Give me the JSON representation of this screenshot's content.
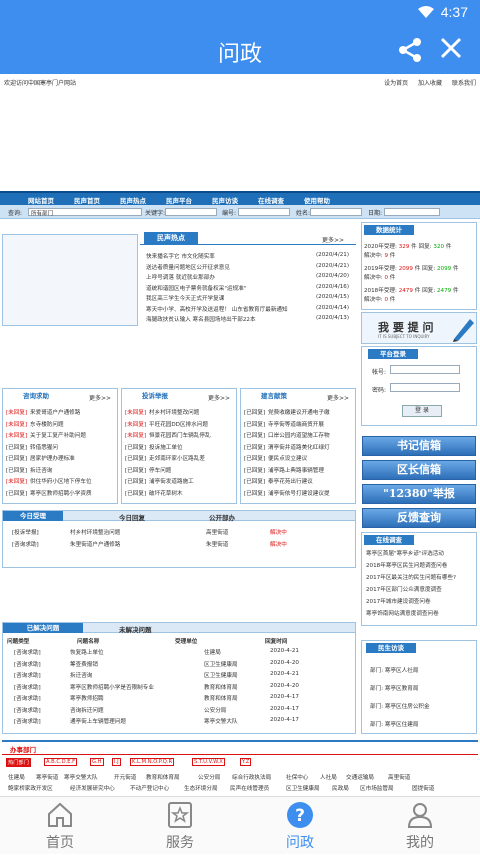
{
  "status": {
    "time": "4:37"
  },
  "appbar": {
    "title": "问政"
  },
  "web": {
    "welcome": "欢迎访问中国寒亭门户网站",
    "top_links": [
      "设为首页",
      "加入收藏",
      "联系我们"
    ],
    "nav": [
      "网站首页",
      "民声首页",
      "民声热点",
      "民声平台",
      "民声访谈",
      "在线调查",
      "使用帮助"
    ],
    "search": {
      "label1": "查询:",
      "dept": "所有部门",
      "label2": "关键字:",
      "label3": "编号:",
      "label4": "姓名:",
      "label5": "日期:"
    },
    "hot": {
      "title": "民声热点",
      "more": "更多>>",
      "items": [
        {
          "t": "快来播名字它    市文化随实率",
          "d": "(2020/4/21)"
        },
        {
          "t": "送达者质量问题地区公开征求意见",
          "d": "(2020/4/21)"
        },
        {
          "t": "上呼号调落    就近就业那部办",
          "d": "(2020/4/20)"
        },
        {
          "t": "道统和谐园区电子票务就备权采\"运规准\"",
          "d": "(2020/4/16)"
        },
        {
          "t": "我区高三学生今天正式开学复课",
          "d": "(2020/4/15)"
        },
        {
          "t": "寒天中小学、高校开学及送返程！ 山东省教育厅最新通知",
          "d": "(2020/4/14)"
        },
        {
          "t": "海腿政扶贫认输入 寒名县园场地出干部22本",
          "d": "(2020/4/13)"
        }
      ]
    },
    "stats": {
      "title": "数据统计",
      "rows": [
        {
          "a": "2020年受理: ",
          "n1": "329",
          "b": " 件 回复: ",
          "n2": "320",
          "c": " 件",
          "pending": "解决中: ",
          "p": "9",
          "pu": " 件"
        },
        {
          "a": "2019年受理: ",
          "n1": "2099",
          "b": " 件 回复: ",
          "n2": "2099",
          "c": " 件",
          "pending": "解决中: ",
          "p": "0",
          "pu": " 件"
        },
        {
          "a": "2018年受理: ",
          "n1": "2479",
          "b": " 件 回复: ",
          "n2": "2479",
          "c": " 件",
          "pending": "解决中: ",
          "p": "0",
          "pu": " 件"
        }
      ]
    },
    "ask": {
      "title": "我 要 提 问",
      "sub": "IT IS SUBJECT TO INQUIRY"
    },
    "login": {
      "title": "平台登录",
      "user": "帐号:",
      "pass": "密码:",
      "btn": "登 录"
    },
    "consult": {
      "title": "咨询求助",
      "more": "更多>>",
      "items": [
        [
          "[未回复]",
          "来爱哥道户户通修路"
        ],
        [
          "[未回复]",
          "东寺楼防问题"
        ],
        [
          "[未回复]",
          "关于复工复产补助问题"
        ],
        [
          "[已回复]",
          "转借悉猩问"
        ],
        [
          "[已回复]",
          "居家护理办理标准"
        ],
        [
          "[已回复]",
          "拆迁咨询"
        ],
        [
          "[未回复]",
          "供住华府小区地下停车位"
        ],
        [
          "[已回复]",
          "寒亭区教师招聘小学资质"
        ]
      ]
    },
    "complaint": {
      "title": "投诉举报",
      "more": "更多>>",
      "items": [
        [
          "[未回复]",
          "村乡村环境整改问题"
        ],
        [
          "[未回复]",
          "平旺花园DD区排水问题"
        ],
        [
          "[未回复]",
          "恒景花园西门车辆乱停乱"
        ],
        [
          "[已回复]",
          "投诉施工单位"
        ],
        [
          "[已回复]",
          "走郊南环家小区路乱差"
        ],
        [
          "[已回复]",
          "停车问题"
        ],
        [
          "[已回复]",
          "浦亭街发道路施工"
        ],
        [
          "[已回复]",
          "破坏花草树木"
        ]
      ]
    },
    "suggest": {
      "title": "建言献策",
      "more": "更多>>",
      "items": [
        [
          "[已回复]",
          "党费收缴建议开通电子缴"
        ],
        [
          "[已回复]",
          "寺亭街等道端商贸开展"
        ],
        [
          "[已回复]",
          "口岸公园内道望施工存物"
        ],
        [
          "[已回复]",
          "渭亭街并道路美化红绿灯"
        ],
        [
          "[已回复]",
          "便民点设立建议"
        ],
        [
          "[已回复]",
          "浦亭路上典路事辆管理"
        ],
        [
          "[已回复]",
          "泰亭花苑出行建议"
        ],
        [
          "[已回复]",
          "浦亭街依号打建设建议提"
        ]
      ]
    },
    "today": {
      "tabs": [
        "今日受理",
        "今日回复",
        "公开部办"
      ],
      "rows": [
        [
          "[投诉举报]",
          "村乡村环境整治问题",
          "高里街道",
          "解决中"
        ],
        [
          "[咨询求助]",
          "朱里街道户户通修路",
          "朱里街道",
          "解决中"
        ]
      ]
    },
    "unsolved": {
      "tabs": [
        "已解决问题",
        "未解决问题"
      ],
      "headers": [
        "问题类型",
        "问题名称",
        "受理单位",
        "回复时间"
      ],
      "rows": [
        [
          "[咨询求助]",
          "恢复路上单位",
          "住建局",
          "2020-4-21"
        ],
        [
          "[咨询求助]",
          "筹查费报销",
          "区卫生健康局",
          "2020-4-20"
        ],
        [
          "[咨询求助]",
          "拆迁咨询",
          "区卫生健康局",
          "2020-4-21"
        ],
        [
          "[咨询求助]",
          "寒亭区教师招聘小学是否限制专业",
          "教育和体育局",
          "2020-4-20"
        ],
        [
          "[咨询求助]",
          "寒亭教师招聘",
          "教育和体育局",
          "2020-4-17"
        ],
        [
          "[咨询求助]",
          "咨询拆迁问题",
          "公安分局",
          "2020-4-17"
        ],
        [
          "[咨询求助]",
          "通亭街上车辆管理问题",
          "寒亭交警大队",
          "2020-4-17"
        ]
      ]
    },
    "side_btns": [
      "书记信箱",
      "区长信箱",
      "\"12380\"举报",
      "反馈查询"
    ],
    "survey": {
      "title": "在线调查",
      "items": [
        "寒亭区首届\"寒亭乡谚\"评选活动",
        "2018年寒亭区民生问题调查问卷",
        "2017年区最关注的民生问题有哪些?",
        "2017年区部门公众满意度调查",
        "2017年城市建设调查问卷",
        "寒亭饰南网站满意度调查问卷"
      ]
    },
    "interview": {
      "title": "民生访谈",
      "items": [
        "部门: 寒亭区人社局",
        "部门: 寒亭区教育局",
        "部门: 寒亭区住房公积金",
        "部门: 寒亭区住建局"
      ]
    },
    "depts": {
      "title": "办事部门",
      "letters": [
        "热门部门",
        "A.B.C.D.E.F",
        "G.H",
        "I.J",
        "K.L.M.N.O.P.Q.R",
        "S.T.U.V.W.X",
        "Y.Z"
      ],
      "row1": [
        "住建局",
        "寒亭街道",
        "寒亭交警大队",
        "开元街道",
        "教育和体育局",
        "公安分局",
        "综合行政执法局",
        "社保中心",
        "人社局",
        "交通运输局",
        "高里街道"
      ],
      "row2": [
        "鲍家桥家政开发区",
        "经济发展研究中心",
        "不动产登记中心",
        "生态环境分局",
        "民声在线管理员",
        "区卫生健康局",
        "民政局",
        "区市场监管局",
        "固提街道"
      ]
    }
  },
  "tabs": [
    {
      "label": "首页",
      "icon": "home-icon"
    },
    {
      "label": "服务",
      "icon": "star-icon"
    },
    {
      "label": "问政",
      "icon": "question-icon"
    },
    {
      "label": "我的",
      "icon": "person-icon"
    }
  ],
  "colors": {
    "primary": "#3e8ef0",
    "web_nav": "#1e6fb8"
  }
}
